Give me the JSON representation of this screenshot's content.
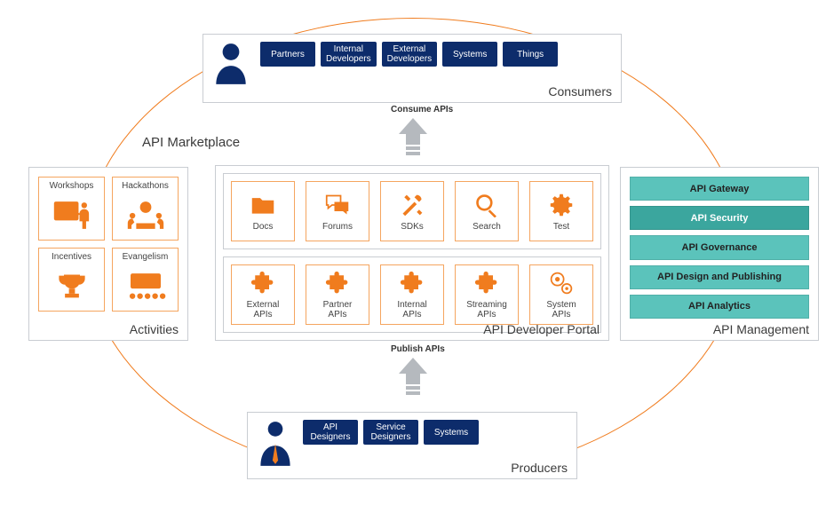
{
  "marketplace_label": "API Marketplace",
  "consumers": {
    "title": "Consumers",
    "items": [
      "Partners",
      "Internal\nDevelopers",
      "External\nDevelopers",
      "Systems",
      "Things"
    ]
  },
  "producers": {
    "title": "Producers",
    "items": [
      "API\nDesigners",
      "Service\nDesigners",
      "Systems"
    ]
  },
  "portal": {
    "title": "API Developer Portal",
    "row1": {
      "docs": "Docs",
      "forums": "Forums",
      "sdks": "SDKs",
      "search": "Search",
      "test": "Test"
    },
    "row2": {
      "external": "External\nAPIs",
      "partner": "Partner\nAPIs",
      "internal": "Internal\nAPIs",
      "streaming": "Streaming\nAPIs",
      "system": "System\nAPIs"
    }
  },
  "activities": {
    "title": "Activities",
    "items": {
      "workshops": "Workshops",
      "hackathons": "Hackathons",
      "incentives": "Incentives",
      "evangelism": "Evangelism"
    }
  },
  "management": {
    "title": "API Management",
    "items": [
      "API Gateway",
      "API Security",
      "API Governance",
      "API Design and Publishing",
      "API Analytics"
    ]
  },
  "arrows": {
    "consume": "Consume APIs",
    "publish": "Publish APIs"
  }
}
